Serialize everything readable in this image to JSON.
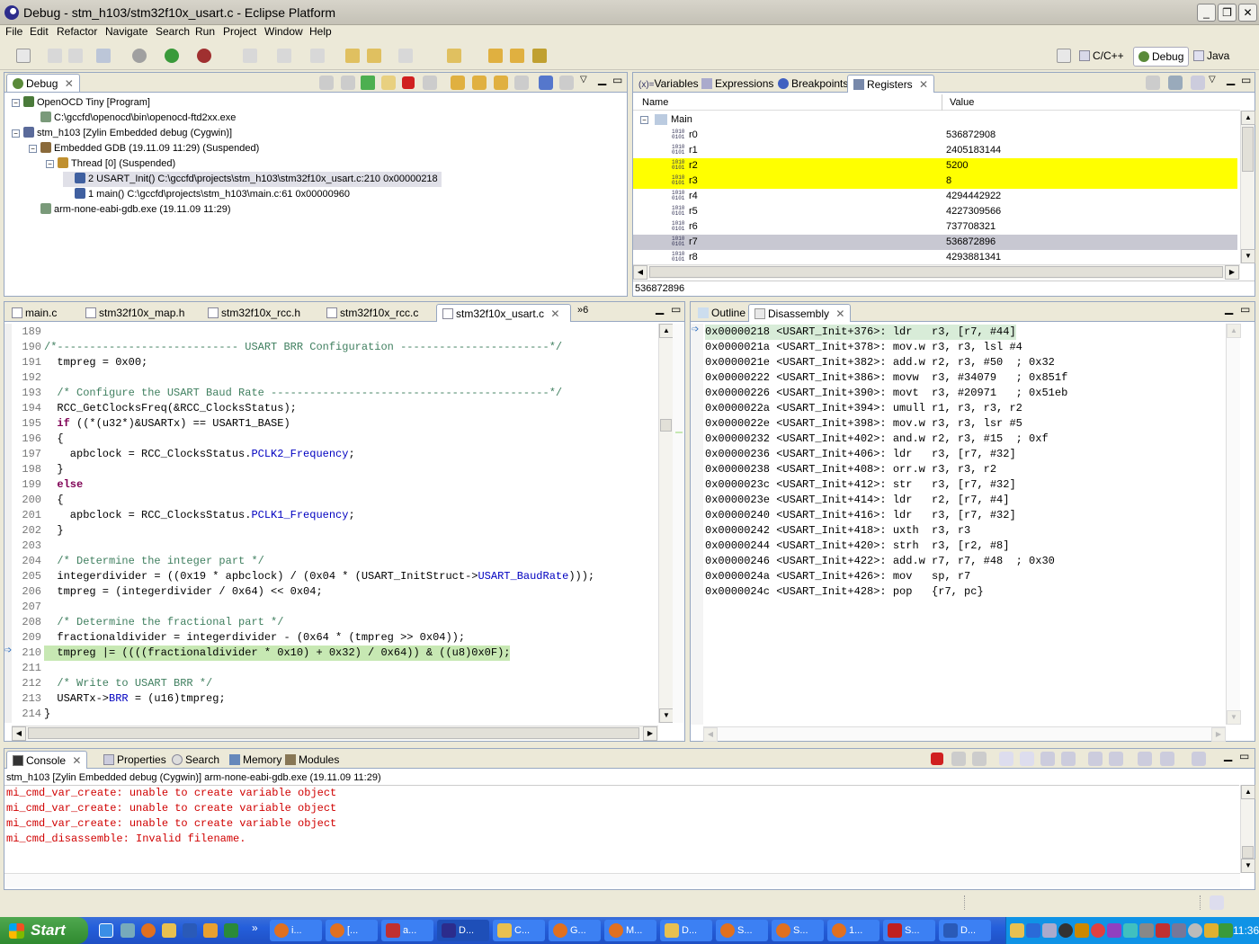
{
  "window": {
    "title": "Debug - stm_h103/stm32f10x_usart.c - Eclipse Platform",
    "minimize": "_",
    "restore": "❐",
    "close": "✕"
  },
  "menu": [
    "File",
    "Edit",
    "Refactor",
    "Navigate",
    "Search",
    "Run",
    "Project",
    "Window",
    "Help"
  ],
  "perspectives": [
    {
      "label": "C/C++",
      "icon": "cpp-perspective-icon"
    },
    {
      "label": "Debug",
      "icon": "debug-perspective-icon"
    },
    {
      "label": "Java",
      "icon": "java-perspective-icon"
    }
  ],
  "debug_view": {
    "tab": "Debug",
    "tree": [
      {
        "level": 0,
        "text": "OpenOCD Tiny [Program]",
        "icon": "launch-icon",
        "expanded": true
      },
      {
        "level": 1,
        "text": "C:\\gccfd\\openocd\\bin\\openocd-ftd2xx.exe",
        "icon": "process-icon"
      },
      {
        "level": 0,
        "text": "stm_h103 [Zylin Embedded debug (Cygwin)]",
        "icon": "c-launch-icon",
        "expanded": true
      },
      {
        "level": 1,
        "text": "Embedded GDB (19.11.09 11:29) (Suspended)",
        "icon": "debug-target-icon",
        "expanded": true
      },
      {
        "level": 2,
        "text": "Thread [0] (Suspended)",
        "icon": "thread-icon",
        "expanded": true
      },
      {
        "level": 3,
        "text": "2 USART_Init() C:\\gccfd\\projects\\stm_h103\\stm32f10x_usart.c:210 0x00000218",
        "icon": "stack-frame-icon",
        "selected": true
      },
      {
        "level": 3,
        "text": "1 main() C:\\gccfd\\projects\\stm_h103\\main.c:61 0x00000960",
        "icon": "stack-frame-icon"
      },
      {
        "level": 1,
        "text": "arm-none-eabi-gdb.exe (19.11.09 11:29)",
        "icon": "process-icon"
      }
    ]
  },
  "registers_view": {
    "tabs": [
      "Variables",
      "Expressions",
      "Breakpoints",
      "Registers"
    ],
    "active_tab": "Registers",
    "columns": [
      "Name",
      "Value"
    ],
    "group": "Main",
    "rows": [
      {
        "name": "r0",
        "value": "536872908",
        "state": "normal"
      },
      {
        "name": "r1",
        "value": "2405183144",
        "state": "normal"
      },
      {
        "name": "r2",
        "value": "5200",
        "state": "changed"
      },
      {
        "name": "r3",
        "value": "8",
        "state": "changed"
      },
      {
        "name": "r4",
        "value": "4294442922",
        "state": "normal"
      },
      {
        "name": "r5",
        "value": "4227309566",
        "state": "normal"
      },
      {
        "name": "r6",
        "value": "737708321",
        "state": "normal"
      },
      {
        "name": "r7",
        "value": "536872896",
        "state": "selected"
      },
      {
        "name": "r8",
        "value": "4293881341",
        "state": "normal"
      }
    ],
    "detail": "536872896"
  },
  "editor": {
    "tabs": [
      "main.c",
      "stm32f10x_map.h",
      "stm32f10x_rcc.h",
      "stm32f10x_rcc.c",
      "stm32f10x_usart.c"
    ],
    "active_tab": "stm32f10x_usart.c",
    "overflow": "»6",
    "current_line": "210",
    "lines": [
      {
        "n": "189",
        "segs": []
      },
      {
        "n": "190",
        "segs": [
          {
            "c": "cm",
            "t": "/*---------------------------- USART BRR Configuration -----------------------*/"
          }
        ]
      },
      {
        "n": "191",
        "segs": [
          {
            "t": "  tmpreg = 0x00;"
          }
        ]
      },
      {
        "n": "192",
        "segs": []
      },
      {
        "n": "193",
        "segs": [
          {
            "c": "cm",
            "t": "  /* Configure the USART Baud Rate -------------------------------------------*/"
          }
        ]
      },
      {
        "n": "194",
        "segs": [
          {
            "t": "  RCC_GetClocksFreq(&RCC_ClocksStatus);"
          }
        ]
      },
      {
        "n": "195",
        "segs": [
          {
            "c": "kw",
            "t": "  if"
          },
          {
            "t": " ((*(u32*)&USARTx) == USART1_BASE)"
          }
        ]
      },
      {
        "n": "196",
        "segs": [
          {
            "t": "  {"
          }
        ]
      },
      {
        "n": "197",
        "segs": [
          {
            "t": "    apbclock = RCC_ClocksStatus."
          },
          {
            "c": "fld",
            "t": "PCLK2_Frequency"
          },
          {
            "t": ";"
          }
        ]
      },
      {
        "n": "198",
        "segs": [
          {
            "t": "  }"
          }
        ]
      },
      {
        "n": "199",
        "segs": [
          {
            "c": "kw",
            "t": "  else"
          }
        ]
      },
      {
        "n": "200",
        "segs": [
          {
            "t": "  {"
          }
        ]
      },
      {
        "n": "201",
        "segs": [
          {
            "t": "    apbclock = RCC_ClocksStatus."
          },
          {
            "c": "fld",
            "t": "PCLK1_Frequency"
          },
          {
            "t": ";"
          }
        ]
      },
      {
        "n": "202",
        "segs": [
          {
            "t": "  }"
          }
        ]
      },
      {
        "n": "203",
        "segs": []
      },
      {
        "n": "204",
        "segs": [
          {
            "c": "cm",
            "t": "  /* Determine the integer part */"
          }
        ]
      },
      {
        "n": "205",
        "segs": [
          {
            "t": "  integerdivider = ((0x19 * apbclock) / (0x04 * (USART_InitStruct->"
          },
          {
            "c": "fld",
            "t": "USART_BaudRate"
          },
          {
            "t": ")));"
          }
        ]
      },
      {
        "n": "206",
        "segs": [
          {
            "t": "  tmpreg = (integerdivider / 0x64) << 0x04;"
          }
        ]
      },
      {
        "n": "207",
        "segs": []
      },
      {
        "n": "208",
        "segs": [
          {
            "c": "cm",
            "t": "  /* Determine the fractional part */"
          }
        ]
      },
      {
        "n": "209",
        "segs": [
          {
            "t": "  fractionaldivider = integerdivider - (0x64 * (tmpreg >> 0x04));"
          }
        ]
      },
      {
        "n": "210",
        "segs": [
          {
            "t": "  tmpreg |= ((((fractionaldivider * 0x10) + 0x32) / 0x64)) & ((u8)0x0F);"
          }
        ]
      },
      {
        "n": "211",
        "segs": []
      },
      {
        "n": "212",
        "segs": [
          {
            "c": "cm",
            "t": "  /* Write to USART BRR */"
          }
        ]
      },
      {
        "n": "213",
        "segs": [
          {
            "t": "  USARTx->"
          },
          {
            "c": "fld",
            "t": "BRR"
          },
          {
            "t": " = (u16)tmpreg;"
          }
        ]
      },
      {
        "n": "214",
        "segs": [
          {
            "t": "}"
          }
        ]
      }
    ]
  },
  "disassembly_view": {
    "tabs": [
      "Outline",
      "Disassembly"
    ],
    "active_tab": "Disassembly",
    "lines": [
      "0x00000218 <USART_Init+376>: ldr   r3, [r7, #44]",
      "0x0000021a <USART_Init+378>: mov.w r3, r3, lsl #4",
      "0x0000021e <USART_Init+382>: add.w r2, r3, #50  ; 0x32",
      "0x00000222 <USART_Init+386>: movw  r3, #34079   ; 0x851f",
      "0x00000226 <USART_Init+390>: movt  r3, #20971   ; 0x51eb",
      "0x0000022a <USART_Init+394>: umull r1, r3, r3, r2",
      "0x0000022e <USART_Init+398>: mov.w r3, r3, lsr #5",
      "0x00000232 <USART_Init+402>: and.w r2, r3, #15  ; 0xf",
      "0x00000236 <USART_Init+406>: ldr   r3, [r7, #32]",
      "0x00000238 <USART_Init+408>: orr.w r3, r3, r2",
      "0x0000023c <USART_Init+412>: str   r3, [r7, #32]",
      "0x0000023e <USART_Init+414>: ldr   r2, [r7, #4]",
      "0x00000240 <USART_Init+416>: ldr   r3, [r7, #32]",
      "0x00000242 <USART_Init+418>: uxth  r3, r3",
      "0x00000244 <USART_Init+420>: strh  r3, [r2, #8]",
      "0x00000246 <USART_Init+422>: add.w r7, r7, #48  ; 0x30",
      "0x0000024a <USART_Init+426>: mov   sp, r7",
      "0x0000024c <USART_Init+428>: pop   {r7, pc}"
    ]
  },
  "console_view": {
    "tabs": [
      "Console",
      "Properties",
      "Search",
      "Memory",
      "Modules"
    ],
    "active_tab": "Console",
    "header": "stm_h103 [Zylin Embedded debug (Cygwin)] arm-none-eabi-gdb.exe (19.11.09 11:29)",
    "lines": [
      "mi_cmd_var_create: unable to create variable object",
      "mi_cmd_var_create: unable to create variable object",
      "mi_cmd_var_create: unable to create variable object",
      "mi_cmd_disassemble: Invalid filename."
    ]
  },
  "taskbar": {
    "start": "Start",
    "tasks": [
      {
        "label": "i...",
        "icon": "firefox-icon"
      },
      {
        "label": "[...",
        "icon": "firefox-icon"
      },
      {
        "label": "a...",
        "icon": "app-icon"
      },
      {
        "label": "D...",
        "icon": "eclipse-icon",
        "active": true
      },
      {
        "label": "C...",
        "icon": "folder-icon"
      },
      {
        "label": "G...",
        "icon": "firefox-icon"
      },
      {
        "label": "M...",
        "icon": "firefox-icon"
      },
      {
        "label": "D...",
        "icon": "folder-icon"
      },
      {
        "label": "S...",
        "icon": "firefox-icon"
      },
      {
        "label": "S...",
        "icon": "firefox-icon"
      },
      {
        "label": "1...",
        "icon": "firefox-icon"
      },
      {
        "label": "S...",
        "icon": "pdf-icon"
      },
      {
        "label": "D...",
        "icon": "word-icon"
      }
    ],
    "clock": "11:36"
  },
  "colors": {
    "changed_bg": "#ffff00",
    "selected_bg": "#c8c8d2",
    "current_line_bg": "#c7e8b3",
    "console_error": "#d00000",
    "titlebar": "#c4c1b6"
  }
}
